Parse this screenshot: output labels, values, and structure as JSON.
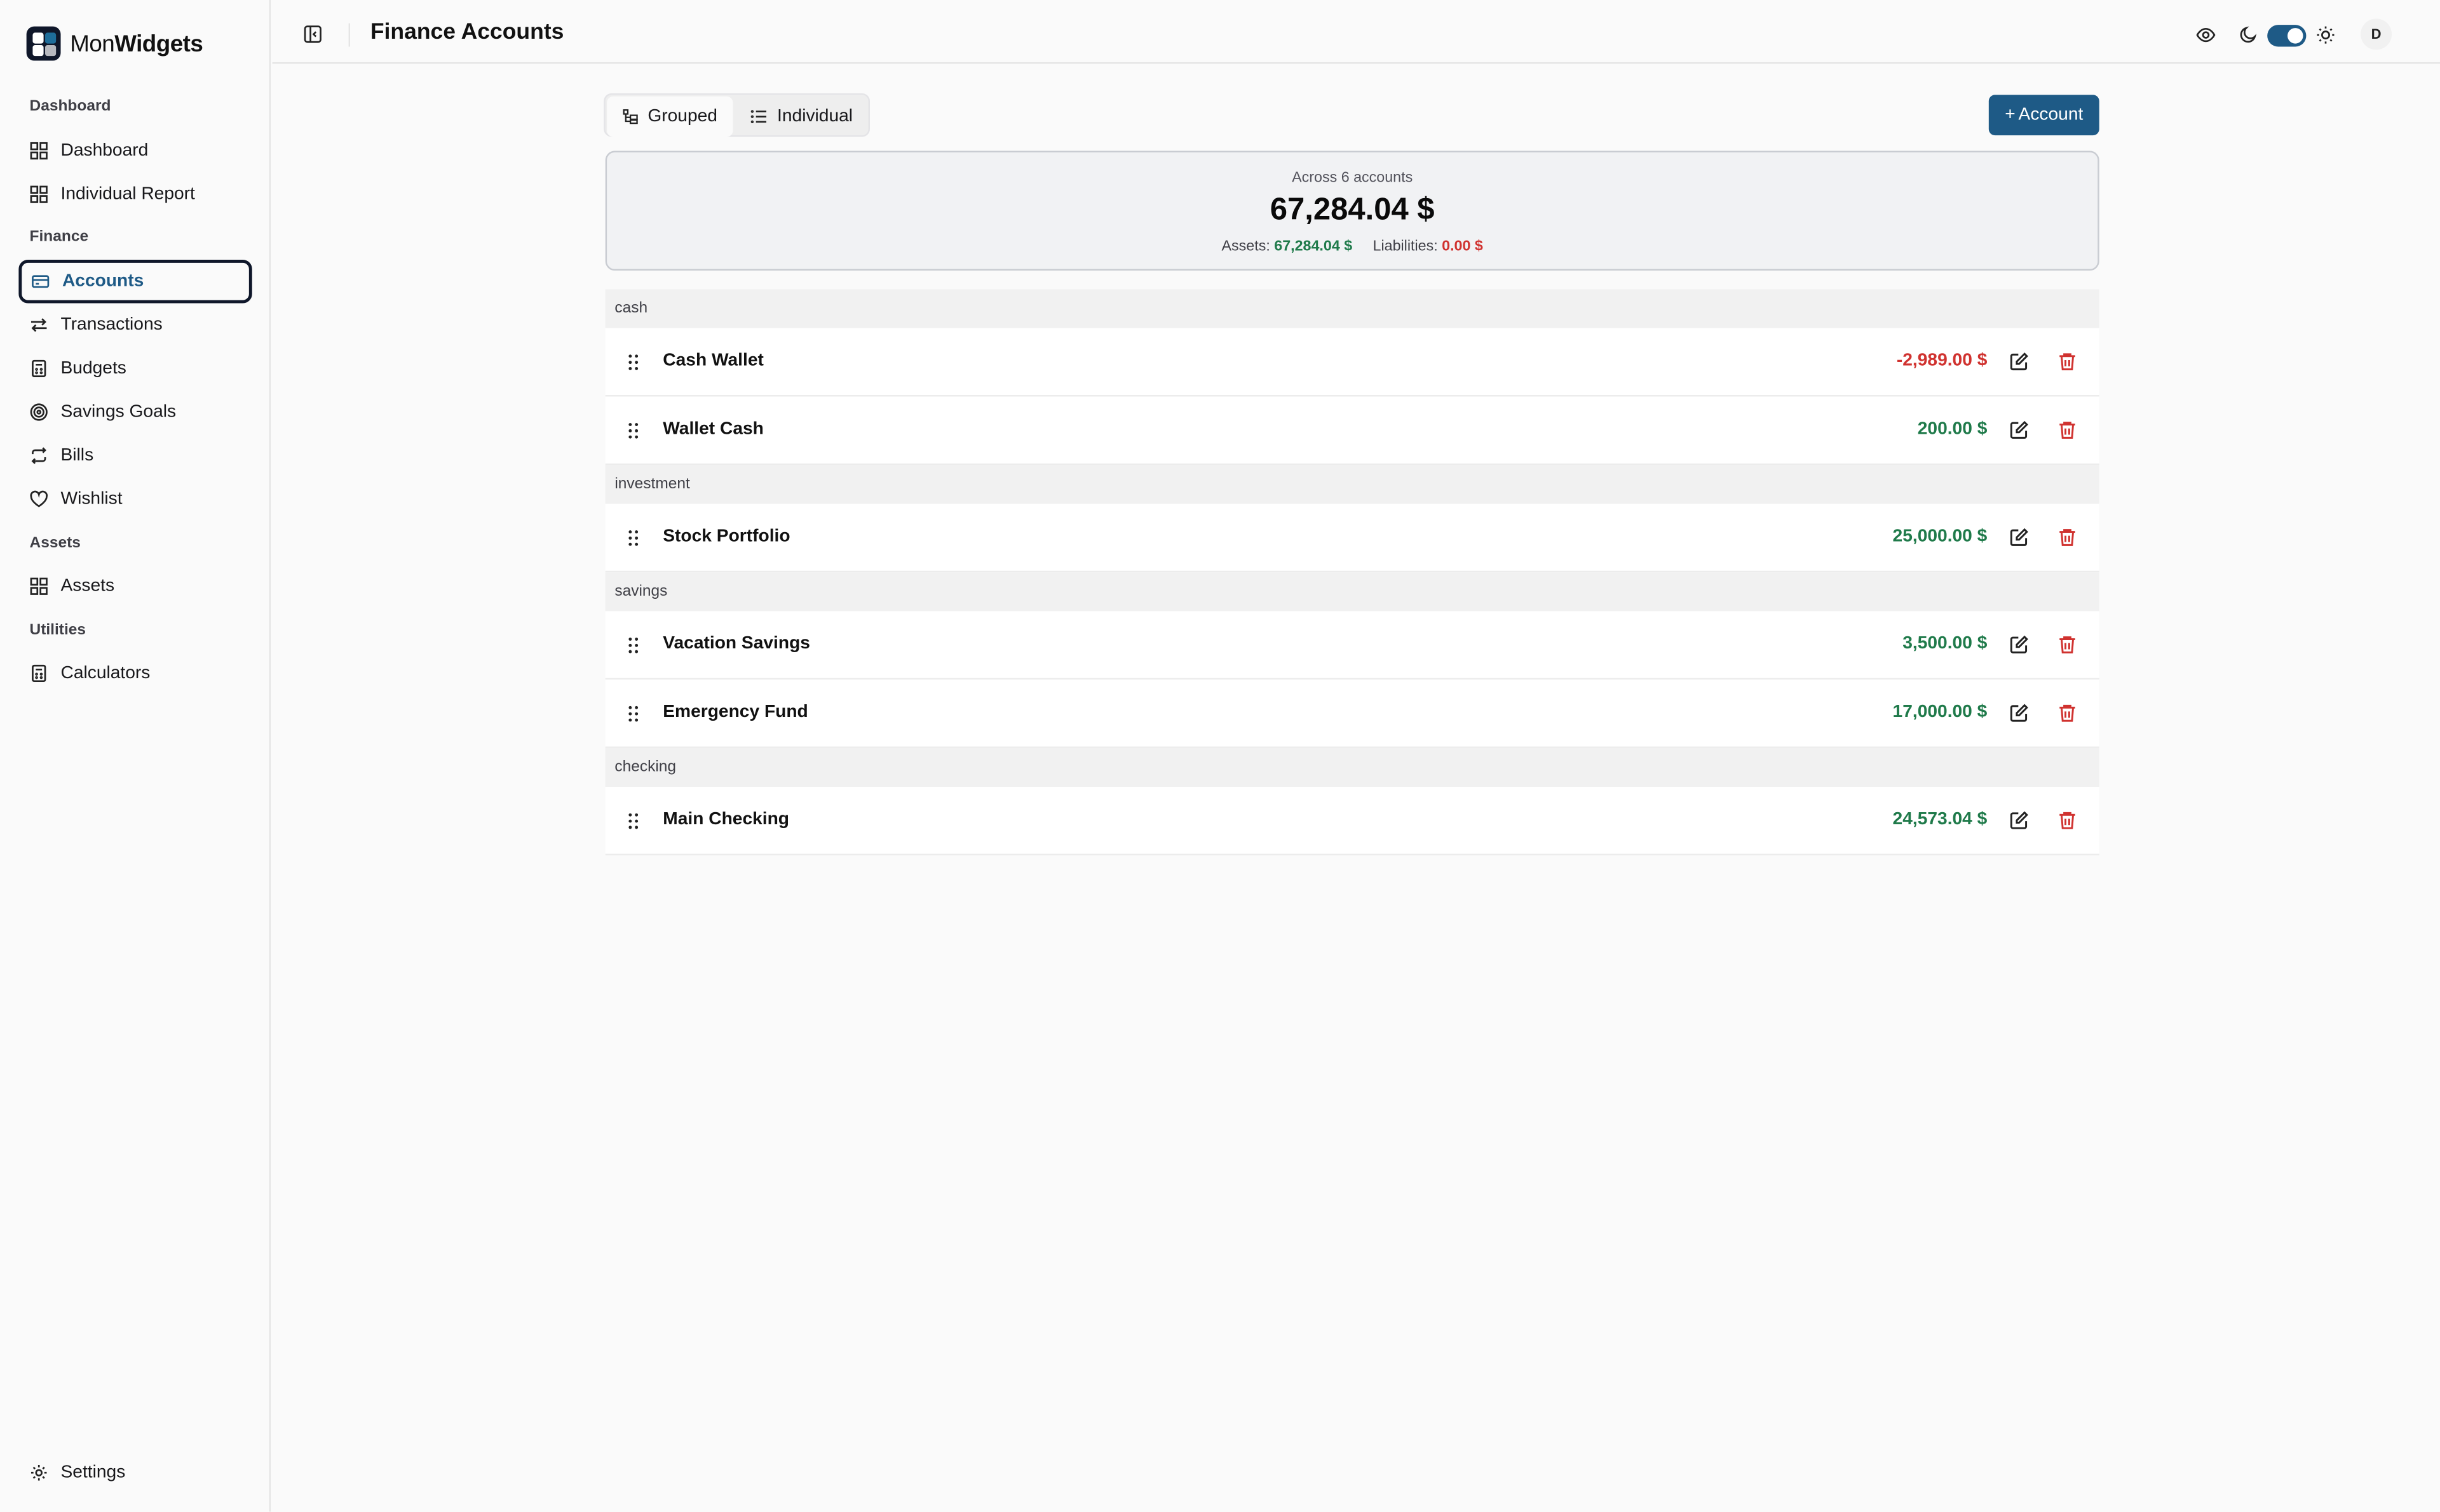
{
  "app": {
    "brand_light": "Mon",
    "brand_bold": "Widgets"
  },
  "sidebar": {
    "sections": [
      {
        "label": "Dashboard",
        "items": [
          {
            "label": "Dashboard",
            "icon": "grid-icon"
          },
          {
            "label": "Individual Report",
            "icon": "grid-icon"
          }
        ]
      },
      {
        "label": "Finance",
        "items": [
          {
            "label": "Accounts",
            "icon": "credit-card-icon",
            "active": true
          },
          {
            "label": "Transactions",
            "icon": "arrows-swap-icon"
          },
          {
            "label": "Budgets",
            "icon": "calculator-icon"
          },
          {
            "label": "Savings Goals",
            "icon": "target-icon"
          },
          {
            "label": "Bills",
            "icon": "repeat-icon"
          },
          {
            "label": "Wishlist",
            "icon": "heart-icon"
          }
        ]
      },
      {
        "label": "Assets",
        "items": [
          {
            "label": "Assets",
            "icon": "grid-icon"
          }
        ]
      },
      {
        "label": "Utilities",
        "items": [
          {
            "label": "Calculators",
            "icon": "calculator-icon"
          }
        ]
      }
    ],
    "settings_label": "Settings"
  },
  "header": {
    "title": "Finance Accounts",
    "avatar_initial": "D"
  },
  "view_toggle": {
    "grouped_label": "Grouped",
    "individual_label": "Individual",
    "selected": "Grouped"
  },
  "add_button": {
    "plus": "+",
    "label": "Account"
  },
  "summary": {
    "caption": "Across 6 accounts",
    "total": "67,284.04 $",
    "assets_label": "Assets:",
    "assets_value": "67,284.04 $",
    "liabilities_label": "Liabilities:",
    "liabilities_value": "0.00 $"
  },
  "groups": [
    {
      "name": "cash",
      "accounts": [
        {
          "name": "Cash Wallet",
          "balance": "-2,989.00 $",
          "negative": true
        },
        {
          "name": "Wallet Cash",
          "balance": "200.00 $",
          "negative": false
        }
      ]
    },
    {
      "name": "investment",
      "accounts": [
        {
          "name": "Stock Portfolio",
          "balance": "25,000.00 $",
          "negative": false
        }
      ]
    },
    {
      "name": "savings",
      "accounts": [
        {
          "name": "Vacation Savings",
          "balance": "3,500.00 $",
          "negative": false
        },
        {
          "name": "Emergency Fund",
          "balance": "17,000.00 $",
          "negative": false
        }
      ]
    },
    {
      "name": "checking",
      "accounts": [
        {
          "name": "Main Checking",
          "balance": "24,573.04 $",
          "negative": false
        }
      ]
    }
  ],
  "colors": {
    "accent": "#1e5a86",
    "positive": "#1f7a4a",
    "negative": "#d0322f"
  }
}
